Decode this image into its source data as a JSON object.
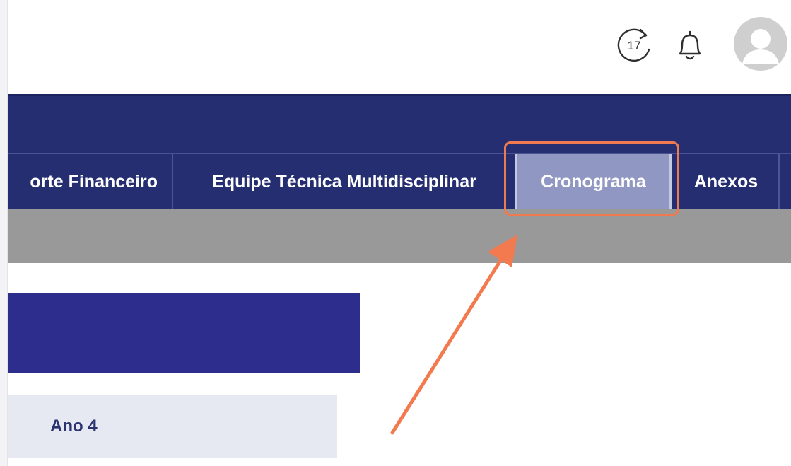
{
  "header": {
    "history_badge": "17",
    "icons": [
      "history-icon",
      "bell-icon",
      "avatar-icon"
    ]
  },
  "tabs": [
    {
      "label": "orte Financeiro",
      "active": false
    },
    {
      "label": "Equipe Técnica Multidisciplinar",
      "active": false
    },
    {
      "label": "Cronograma",
      "active": true
    },
    {
      "label": "Anexos",
      "active": false
    }
  ],
  "content": {
    "year_label": "Ano 4"
  },
  "colors": {
    "nav": "#262e72",
    "active_tab": "#8f97c2",
    "subband": "#999999",
    "card_header": "#2c2d8d",
    "highlight": "#f07a4f"
  }
}
